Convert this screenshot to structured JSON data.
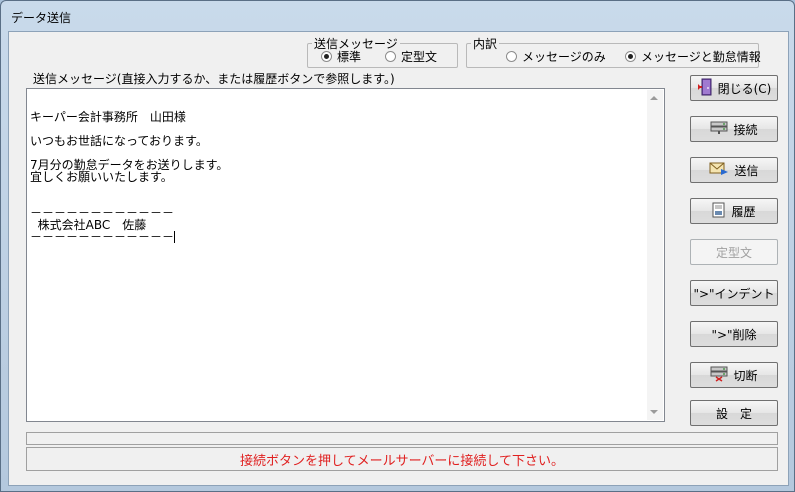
{
  "window": {
    "title": "データ送信"
  },
  "send_message_group": {
    "legend": "送信メッセージ",
    "options": [
      {
        "label": "標準",
        "selected": true
      },
      {
        "label": "定型文",
        "selected": false
      }
    ]
  },
  "detail_group": {
    "legend": "内訳",
    "options": [
      {
        "label": "メッセージのみ",
        "selected": false
      },
      {
        "label": "メッセージと勤怠情報",
        "selected": true
      }
    ]
  },
  "message_area": {
    "label": "送信メッセージ(直接入力するか、または履歴ボタンで参照します。)",
    "lines": [
      "",
      "キーパー会計事務所　山田様",
      "",
      "いつもお世話になっております。",
      "",
      "7月分の勤怠データをお送りします。",
      "宜しくお願いいたします。",
      "",
      "",
      "－－－－－－－－－－－－",
      "  株式会社ABC　佐藤",
      "－－－－－－－－－－－－"
    ]
  },
  "buttons": {
    "close": "閉じる(C)",
    "connect": "接続",
    "send": "送信",
    "history": "履歴",
    "template": "定型文",
    "indent": "\">\"インデント",
    "delete_quote": "\">\"削除",
    "disconnect": "切断",
    "settings": "設　定"
  },
  "status": {
    "message": "接続ボタンを押してメールサーバーに接続して下さい。",
    "message_color": "#e02020"
  },
  "icons": {
    "close": "door-exit-icon",
    "connect": "server-icon",
    "send": "mail-send-icon",
    "history": "document-icon",
    "disconnect": "server-disconnect-icon"
  }
}
